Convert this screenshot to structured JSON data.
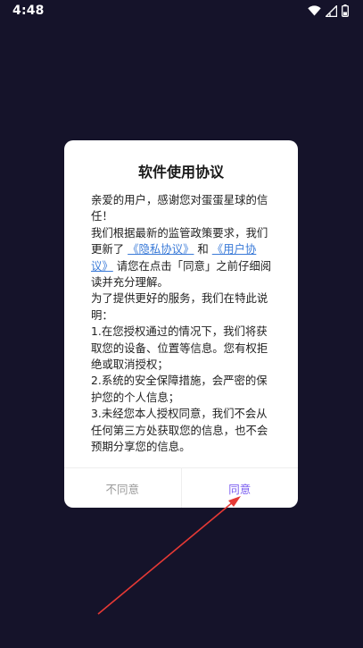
{
  "status_bar": {
    "time": "4:48",
    "icons": [
      "wifi-icon",
      "signal-icon",
      "battery-icon"
    ]
  },
  "dialog": {
    "title": "软件使用协议",
    "body": {
      "p1": "亲爱的用户，感谢您对蛋蛋星球的信任！",
      "p2_prefix": "我们根据最新的监管政策要求，我们更新了",
      "privacy_link": "《隐私协议》",
      "and_text": "和",
      "user_link": "《用户协议》",
      "p2_suffix": "请您在点击「同意」之前仔细阅读并充分理解。",
      "p3": "为了提供更好的服务，我们在特此说明：",
      "item1": "1.在您授权通过的情况下，我们将获取您的设备、位置等信息。您有权拒绝或取消授权；",
      "item2": "2.系统的安全保障措施，会严密的保护您的个人信息；",
      "item3": "3.未经您本人授权同意，我们不会从任何第三方处获取您的信息，也不会预期分享您的信息。"
    },
    "disagree_label": "不同意",
    "agree_label": "同意"
  },
  "colors": {
    "background": "#15132a",
    "link": "#3b7bd8",
    "agree": "#7a5cf0",
    "disagree": "#9a9a9a",
    "annotation_arrow": "#e53935"
  }
}
